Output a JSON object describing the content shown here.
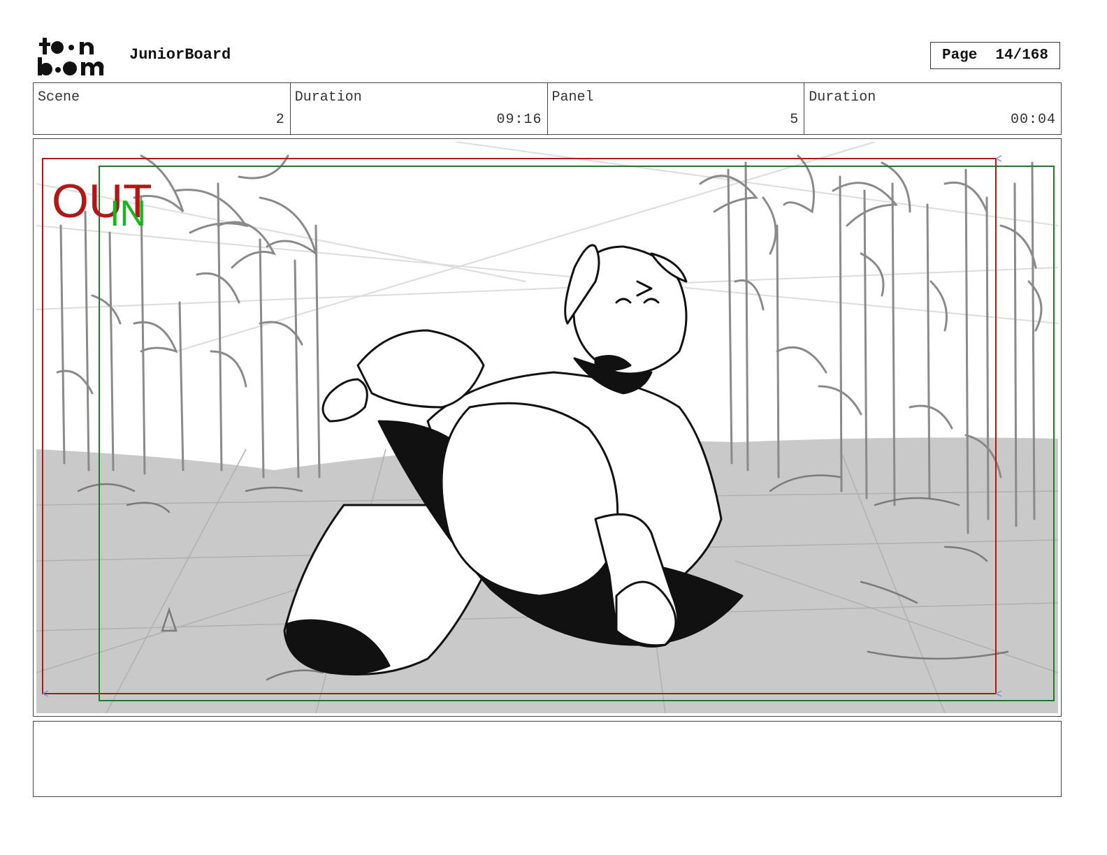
{
  "header": {
    "logo_text": "toon boom",
    "app_title": "JuniorBoard",
    "page_label": "Page",
    "page_number": "14/168"
  },
  "info": [
    {
      "label": "Scene",
      "value": "2"
    },
    {
      "label": "Duration",
      "value": "09:16"
    },
    {
      "label": "Panel",
      "value": "5"
    },
    {
      "label": "Duration",
      "value": "00:04"
    }
  ],
  "panel": {
    "out_label": "OUT",
    "in_label": "IN",
    "colors": {
      "out_frame": "#b01818",
      "in_frame": "#1f7a2a",
      "in_text": "#19b51f",
      "ground": "#c9c9c9",
      "sketch": "#8a8a8a"
    }
  },
  "notes": {
    "text": ""
  }
}
